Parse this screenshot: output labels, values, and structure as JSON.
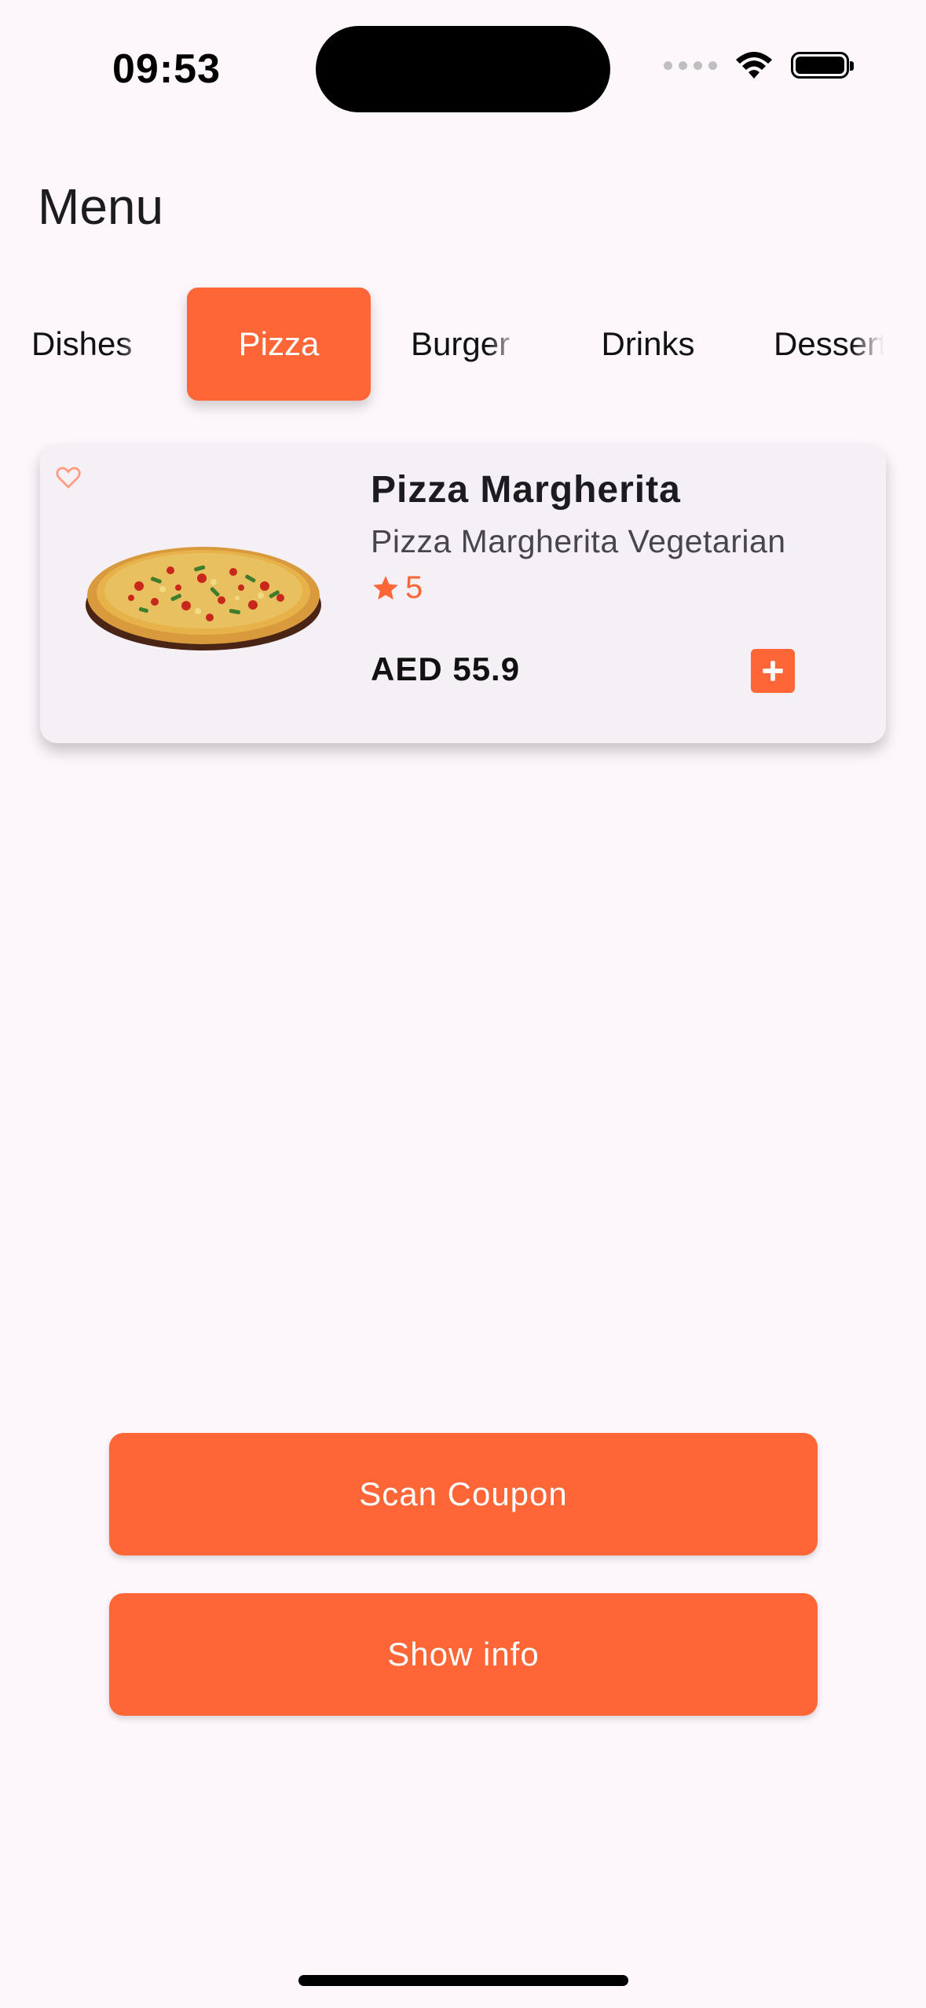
{
  "status_bar": {
    "time": "09:53",
    "wifi_icon": "wifi-icon",
    "battery_icon": "battery-icon"
  },
  "header": {
    "title": "Menu"
  },
  "tabs": [
    {
      "label": "Dishes",
      "active": false
    },
    {
      "label": "Pizza",
      "active": true
    },
    {
      "label": "Burger",
      "active": false
    },
    {
      "label": "Drinks",
      "active": false
    },
    {
      "label": "Desserts",
      "active": false
    }
  ],
  "menu_items": [
    {
      "name": "Pizza Margherita",
      "description": "Pizza Margherita Vegetarian",
      "rating": "5",
      "price": "AED 55.9",
      "favorite_icon": "heart-outline-icon",
      "add_icon": "plus-icon"
    }
  ],
  "actions": {
    "scan_coupon": "Scan Coupon",
    "show_info": "Show info"
  },
  "colors": {
    "accent": "#FF6637",
    "background": "#FDF7FC",
    "card": "#F4F0F6"
  }
}
